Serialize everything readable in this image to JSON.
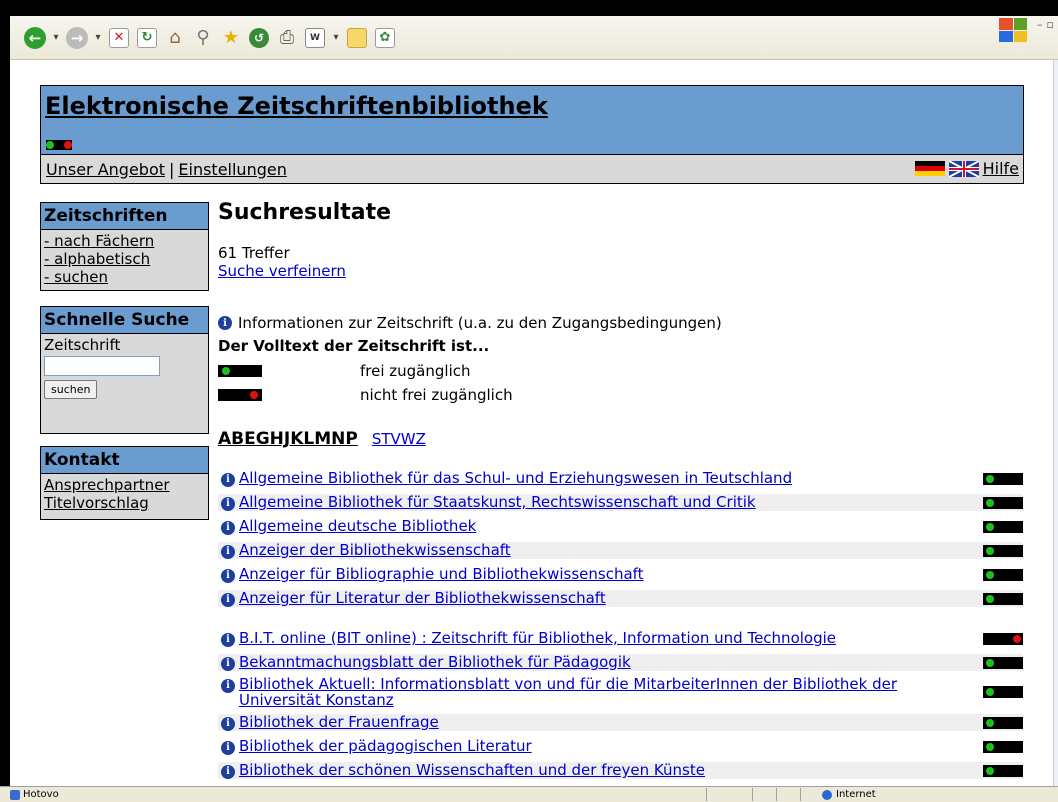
{
  "header": {
    "title": "Elektronische Zeitschriftenbibliothek",
    "nav": [
      "Unser Angebot",
      "|",
      "Einstellungen"
    ],
    "help": "Hilfe"
  },
  "sidebar": {
    "journals": {
      "title": "Zeitschriften",
      "links": [
        "- nach Fächern",
        "- alphabetisch",
        "- suchen"
      ]
    },
    "quick_search": {
      "title": "Schnelle Suche",
      "label": "Zeitschrift",
      "input_value": "",
      "button": "suchen"
    },
    "contact": {
      "title": "Kontakt",
      "links": [
        "Ansprechpartner",
        "Titelvorschlag"
      ]
    }
  },
  "main": {
    "heading": "Suchresultate",
    "hits": "61 Treffer",
    "refine": "Suche verfeinern",
    "info_legend": "Informationen zur Zeitschrift (u.a. zu den Zugangsbedingungen)",
    "legend_title": "Der Volltext der Zeitschrift ist...",
    "legend_free": "frei zugänglich",
    "legend_not_free": "nicht frei zugänglich",
    "letters_current": "ABEGHJKLMNP",
    "letters_other": "STVWZ",
    "results": [
      {
        "title": "Allgemeine Bibliothek für das Schul- und Erziehungswesen in Teutschland",
        "access": "free"
      },
      {
        "title": "Allgemeine Bibliothek für Staatskunst, Rechtswissenschaft und Critik",
        "access": "free"
      },
      {
        "title": "Allgemeine deutsche Bibliothek",
        "access": "free"
      },
      {
        "title": "Anzeiger der Bibliothekwissenschaft",
        "access": "free"
      },
      {
        "title": "Anzeiger für Bibliographie und Bibliothekwissenschaft",
        "access": "free"
      },
      {
        "title": "Anzeiger für Literatur der Bibliothekwissenschaft",
        "access": "free"
      },
      {
        "title": "B.I.T. online (BIT online) : Zeitschrift für Bibliothek, Information und Technologie",
        "access": "not-free"
      },
      {
        "title": "Bekanntmachungsblatt der Bibliothek für Pädagogik",
        "access": "free"
      },
      {
        "title": "Bibliothek Aktuell: Informationsblatt von und für die MitarbeiterInnen der Bibliothek der Universität Konstanz",
        "access": "free"
      },
      {
        "title": "Bibliothek der Frauenfrage",
        "access": "free"
      },
      {
        "title": "Bibliothek der pädagogischen Literatur",
        "access": "free"
      },
      {
        "title": "Bibliothek der schönen Wissenschaften und der freyen Künste",
        "access": "free"
      }
    ]
  },
  "statusbar": {
    "left": "Hotovo",
    "zone": "Internet"
  },
  "colors": {
    "header_bg": "#6b9ccf",
    "nav_bg": "#d9d9d9",
    "link": "#0000cc",
    "free_dot": "#1ec21e",
    "not_free_dot": "#e21010"
  }
}
